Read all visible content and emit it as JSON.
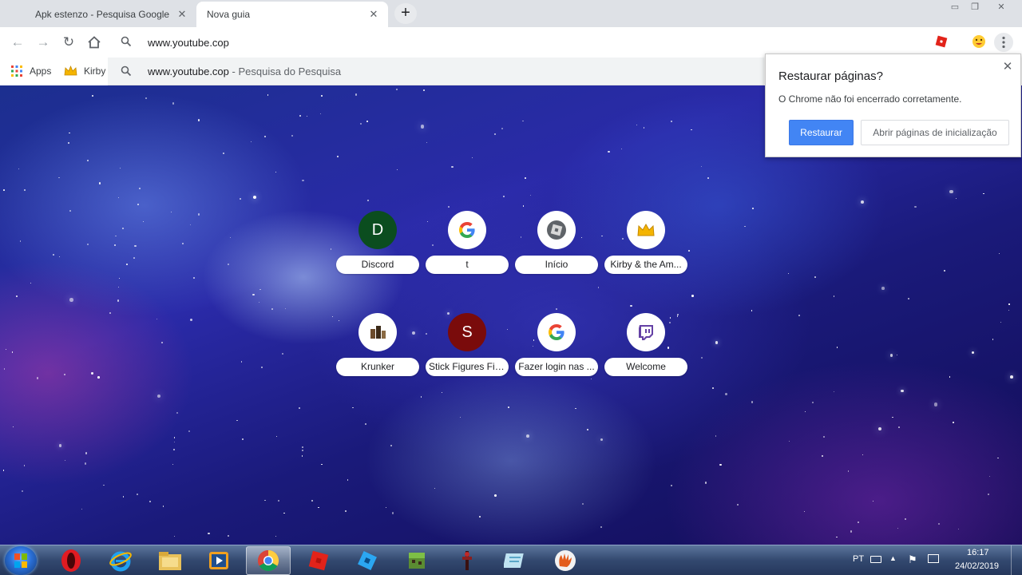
{
  "tabs": [
    {
      "title": "Apk estenzo - Pesquisa Google",
      "active": false
    },
    {
      "title": "Nova guia",
      "active": true
    }
  ],
  "new_tab_symbol": "+",
  "window_controls": [
    "minimize",
    "restore",
    "close"
  ],
  "omnibox": {
    "value": "www.youtube.cop",
    "suggestion_main": "www.youtube.cop",
    "suggestion_sub": " - Pesquisa do Pesquisa"
  },
  "bookmarks": [
    {
      "label": "Apps",
      "icon": "apps-grid-icon"
    },
    {
      "label": "Kirby",
      "icon": "crown-icon"
    }
  ],
  "restore_bubble": {
    "title": "Restaurar páginas?",
    "message": "O Chrome não foi encerrado corretamente.",
    "restore_label": "Restaurar",
    "startup_label": "Abrir páginas de inicialização"
  },
  "tiles": [
    {
      "label": "Discord",
      "letter": "D",
      "color": "#0b4d1f",
      "icon": "letter-icon"
    },
    {
      "label": "t",
      "letter": "",
      "color": "#ffffff",
      "icon": "google-icon"
    },
    {
      "label": "Início",
      "letter": "",
      "color": "#ffffff",
      "icon": "roblox-icon"
    },
    {
      "label": "Kirby & the Am...",
      "letter": "",
      "color": "#ffffff",
      "icon": "crown-icon"
    },
    {
      "label": "Krunker",
      "letter": "",
      "color": "#ffffff",
      "icon": "krunker-icon"
    },
    {
      "label": "Stick Figures Fig...",
      "letter": "S",
      "color": "#7a0b0b",
      "icon": "letter-icon"
    },
    {
      "label": "Fazer login nas ...",
      "letter": "",
      "color": "#ffffff",
      "icon": "google-icon"
    },
    {
      "label": "Welcome",
      "letter": "",
      "color": "#ffffff",
      "icon": "twitch-icon"
    }
  ],
  "taskbar": {
    "apps": [
      "opera-icon",
      "internet-explorer-icon",
      "file-explorer-icon",
      "media-player-icon",
      "chrome-icon",
      "roblox-icon",
      "roblox-studio-icon",
      "minecraft-icon",
      "game-icon",
      "notepad-icon",
      "glove-icon"
    ],
    "language": "PT",
    "time": "16:17",
    "date": "24/02/2019"
  }
}
